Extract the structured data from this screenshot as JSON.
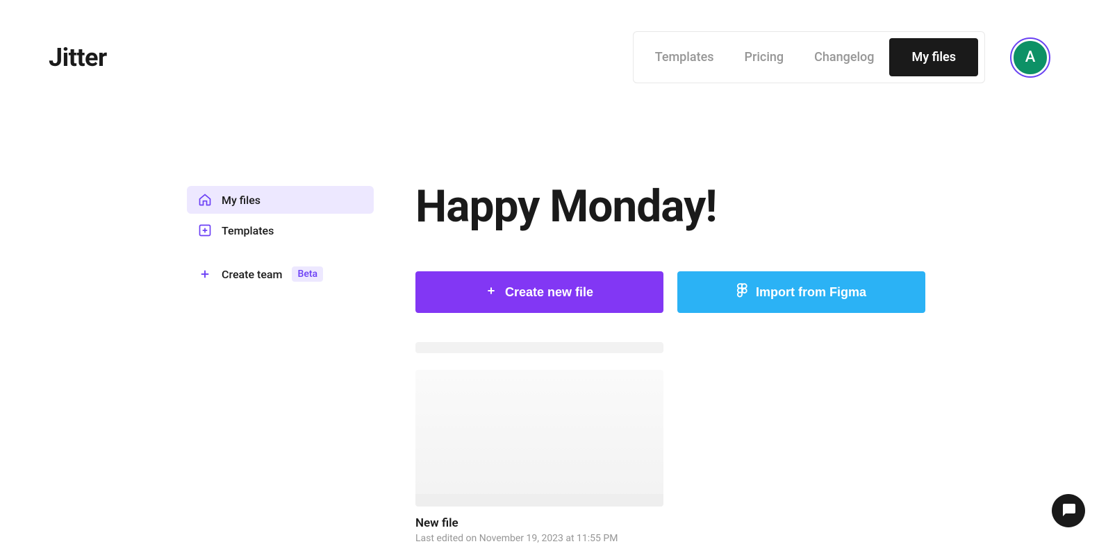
{
  "brand": "Jitter",
  "nav": {
    "items": [
      "Templates",
      "Pricing",
      "Changelog",
      "My files"
    ],
    "active_index": 3
  },
  "avatar": {
    "initial": "A"
  },
  "sidebar": {
    "items": [
      {
        "label": "My files",
        "icon": "home",
        "active": true
      },
      {
        "label": "Templates",
        "icon": "template-plus",
        "active": false
      }
    ],
    "create_team": {
      "label": "Create team",
      "badge": "Beta"
    }
  },
  "main": {
    "greeting": "Happy Monday!",
    "create_button": "Create new file",
    "import_button": "Import from Figma"
  },
  "files": [
    {
      "name": "New file",
      "meta": "Last edited on November 19, 2023 at 11:55 PM"
    }
  ],
  "colors": {
    "purple": "#8237f4",
    "blue": "#2bb2f5",
    "dark": "#1a1a1a",
    "gray": "#969696",
    "light_purple": "#ede8ff",
    "avatar_green": "#0d9166"
  }
}
